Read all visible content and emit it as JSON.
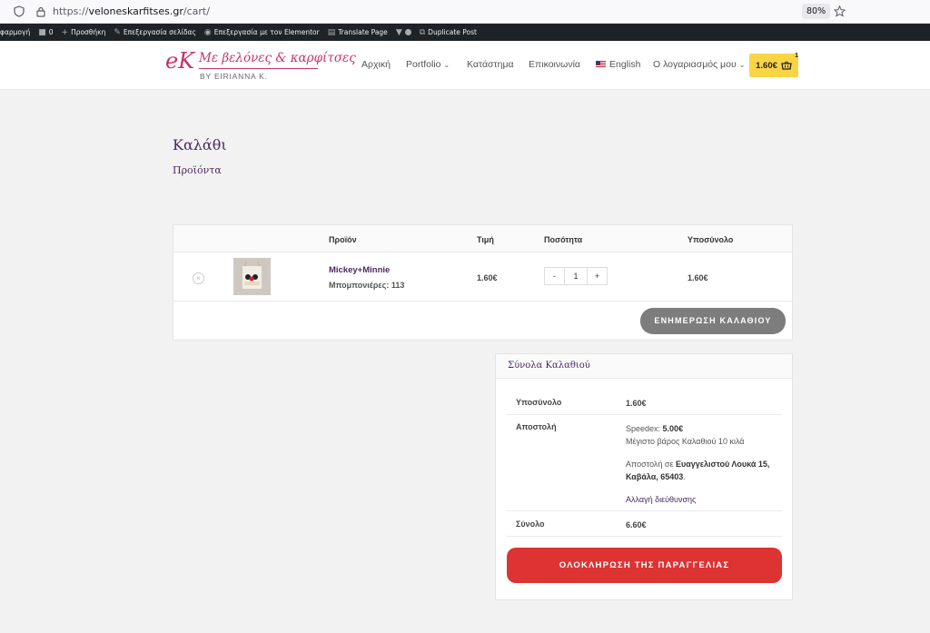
{
  "browser": {
    "url_prefix": "https://",
    "url_domain": "veloneskarfitses.gr",
    "url_path": "/cart/",
    "zoom": "80%"
  },
  "adminbar": {
    "items": [
      "φαρμογή",
      "0",
      "Προσθήκη",
      "Επεξεργασία σελίδας",
      "Επεξεργασία με τον Elementor",
      "Translate Page",
      "Duplicate Post"
    ]
  },
  "header": {
    "logo_mark": "eK",
    "logo_name": "Με βελόνες & καρφίτσες",
    "logo_by": "BY EIRIANNA K.",
    "nav": [
      "Αρχική",
      "Portfolio",
      "Κατάστημα",
      "Επικοινωνία",
      "English",
      "Ο λογαριασμός μου"
    ],
    "cart_total": "1.60€",
    "cart_count": "1"
  },
  "page": {
    "title": "Καλάθι",
    "breadcrumb": "Προϊόντα"
  },
  "cart": {
    "columns": [
      "Προϊόν",
      "Τιμή",
      "Ποσότητα",
      "Υποσύνολο"
    ],
    "item": {
      "name": "Mickey+Minnie",
      "meta": "Μπομπονιέρες: 113",
      "price": "1.60€",
      "qty_minus": "-",
      "qty": "1",
      "qty_plus": "+",
      "subtotal": "1.60€"
    },
    "update_label": "ΕΝΗΜΕΡΩΣΗ ΚΑΛΑΘΙΟΥ"
  },
  "totals": {
    "heading": "Σύνολα Καλαθιού",
    "subtotal_label": "Υποσύνολο",
    "subtotal_value": "1.60€",
    "shipping_label": "Αποστολή",
    "shipping_method": "Speedex:",
    "shipping_cost": "5.00€",
    "shipping_note": "Μέγιστο βάρος Καλαθιού 10 κιλά",
    "shipping_to_prefix": "Αποστολή σε",
    "shipping_address": "Ευαγγελιστού Λουκά 15, Καβάλα, 65403",
    "change_address": "Αλλαγή διεύθυνσης",
    "total_label": "Σύνολο",
    "total_value": "6.60€",
    "checkout_label": "ΟΛΟΚΛΗΡΩΣΗ ΤΗΣ ΠΑΡΑΓΓΕΛΙΑΣ"
  },
  "colors": {
    "accent_purple": "#4a2a5e",
    "cart_yellow": "#f9d545",
    "checkout_red": "#dd3333",
    "update_gray": "#7d7d7d"
  }
}
